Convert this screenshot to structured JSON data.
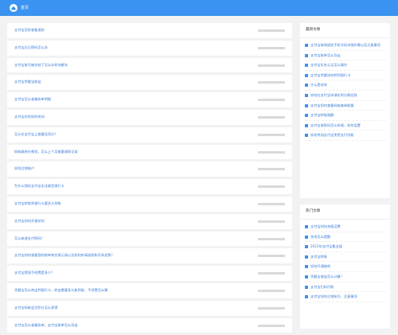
{
  "header": {
    "home_label": "首页",
    "accent": "#3a93f0"
  },
  "articles": [
    {
      "title": "支付宝怎样查看退款"
    },
    {
      "title": "支付宝忘记密码怎么办"
    },
    {
      "title": "支付宝账号被冻结了怎么办如何解冻"
    },
    {
      "title": "支付宝余额宝收益"
    },
    {
      "title": "支付宝怎么查看账单明细"
    },
    {
      "title": "支付宝花呗如何关闭"
    },
    {
      "title": "怎么在支付宝上查看信用分？"
    },
    {
      "title": "蚂蚁森林在哪里，怎么上个月能量收取记录"
    },
    {
      "title": "如何注销账户"
    },
    {
      "title": "为什么我的支付宝无法绑定银行卡"
    },
    {
      "title": "支付宝转账到银行卡要多久到账"
    },
    {
      "title": "支付宝如何开通花呗"
    },
    {
      "title": "怎么修改支付密码？"
    },
    {
      "title": "支付宝如何查看我的账单和交易记录以及如何申请退款和开具发票？"
    },
    {
      "title": "支付宝提现手续费是多少？"
    },
    {
      "title": "余额宝怎么转出到银行卡，转出需要多久能到账，手续费怎么算"
    },
    {
      "title": "支付宝蚂蚁会员积分怎么获得"
    },
    {
      "title": "支付宝怎么查看账单，支付宝账单怎么导出"
    }
  ],
  "sidebar": {
    "latest_title": "最新文章",
    "latest": [
      {
        "title": "支付宝修改绑定手机号码详细步骤以及注意事项"
      },
      {
        "title": "支付宝账单怎么导出"
      },
      {
        "title": "支付宝实名认证怎么操作"
      },
      {
        "title": "支付宝余额如何转到银行卡"
      },
      {
        "title": "什么是花呗"
      },
      {
        "title": "如何在支付宝申请花呗分期还款"
      },
      {
        "title": "支付宝如何查看蚂蚁森林能量"
      },
      {
        "title": "支付宝转账限额"
      },
      {
        "title": "支付宝收款码怎么申请，如何设置"
      },
      {
        "title": "如何关闭支付宝免密支付功能"
      }
    ],
    "hot_title": "热门文章",
    "hot": [
      {
        "title": "支付宝如何充值话费"
      },
      {
        "title": "花呗怎么提额"
      },
      {
        "title": "2021年支付宝集五福"
      },
      {
        "title": "支付宝转账"
      },
      {
        "title": "如何开通借呗"
      },
      {
        "title": "余额宝收益怎么计算？"
      },
      {
        "title": "支付宝扫码付款"
      },
      {
        "title": "支付宝如何注销账号，注意事项"
      }
    ]
  }
}
